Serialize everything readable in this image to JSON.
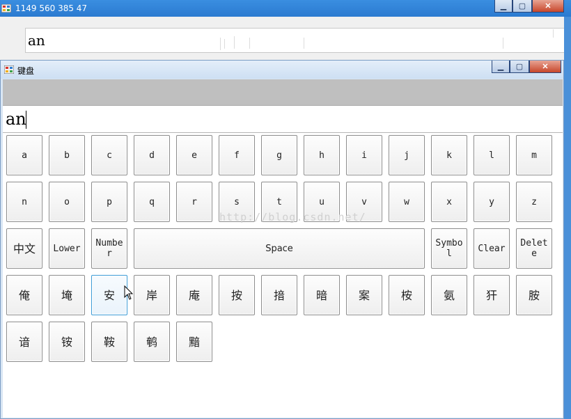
{
  "parent_window": {
    "title": "1149 560 385 47",
    "textbox_value": "an",
    "colors": {
      "titlebar": "#2b7ad0"
    }
  },
  "keyboard_window": {
    "title": "键盘",
    "input_value": "an",
    "colors": {
      "header_band": "#bfbfbf",
      "hover_key_border": "#3c9bd6"
    }
  },
  "keys": {
    "row1": [
      "a",
      "b",
      "c",
      "d",
      "e",
      "f",
      "g",
      "h",
      "i",
      "j",
      "k",
      "l",
      "m"
    ],
    "row2": [
      "n",
      "o",
      "p",
      "q",
      "r",
      "s",
      "t",
      "u",
      "v",
      "w",
      "x",
      "y",
      "z"
    ],
    "row3": {
      "chinese": "中文",
      "lower": "Lower",
      "number": "Number",
      "space": "Space",
      "symbol": "Symbol",
      "clear": "Clear",
      "delete": "Delete"
    },
    "candidates_row1": [
      "俺",
      "埯",
      "安",
      "岸",
      "庵",
      "按",
      "揞",
      "暗",
      "案",
      "桉",
      "氨",
      "犴",
      "胺"
    ],
    "candidates_row2": [
      "谙",
      "铵",
      "鞍",
      "鹌",
      "黯"
    ]
  },
  "hovered_key": "安",
  "watermark": "http://blog.csdn.net/"
}
